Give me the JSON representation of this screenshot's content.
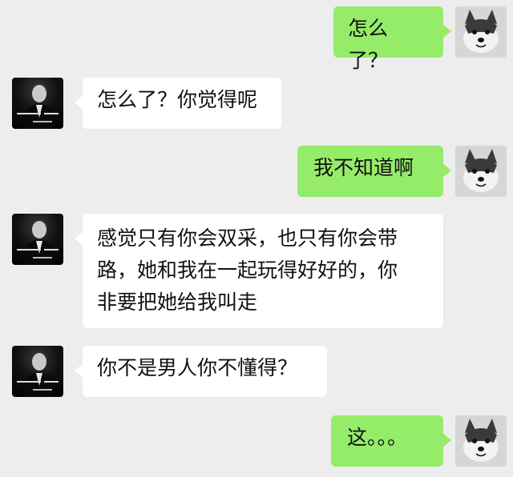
{
  "messages": [
    {
      "side": "right",
      "text": "怎么了？",
      "avatar_icon": "husky-dog-avatar"
    },
    {
      "side": "left",
      "text": "怎么了？你觉得呢",
      "avatar_icon": "man-in-suit-avatar"
    },
    {
      "side": "right",
      "text": "我不知道啊",
      "avatar_icon": "husky-dog-avatar"
    },
    {
      "side": "left",
      "lines": [
        "感觉只有你会双采，也只有你会带",
        "路，她和我在一起玩得好好的，你",
        "非要把她给我叫走"
      ],
      "avatar_icon": "man-in-suit-avatar"
    },
    {
      "side": "left",
      "text": "你不是男人你不懂得？",
      "avatar_icon": "man-in-suit-avatar"
    },
    {
      "side": "right",
      "text": "这。。。",
      "avatar_icon": "husky-dog-avatar"
    }
  ],
  "colors": {
    "background": "#ededed",
    "sent_bubble": "#95ec69",
    "received_bubble": "#ffffff"
  }
}
